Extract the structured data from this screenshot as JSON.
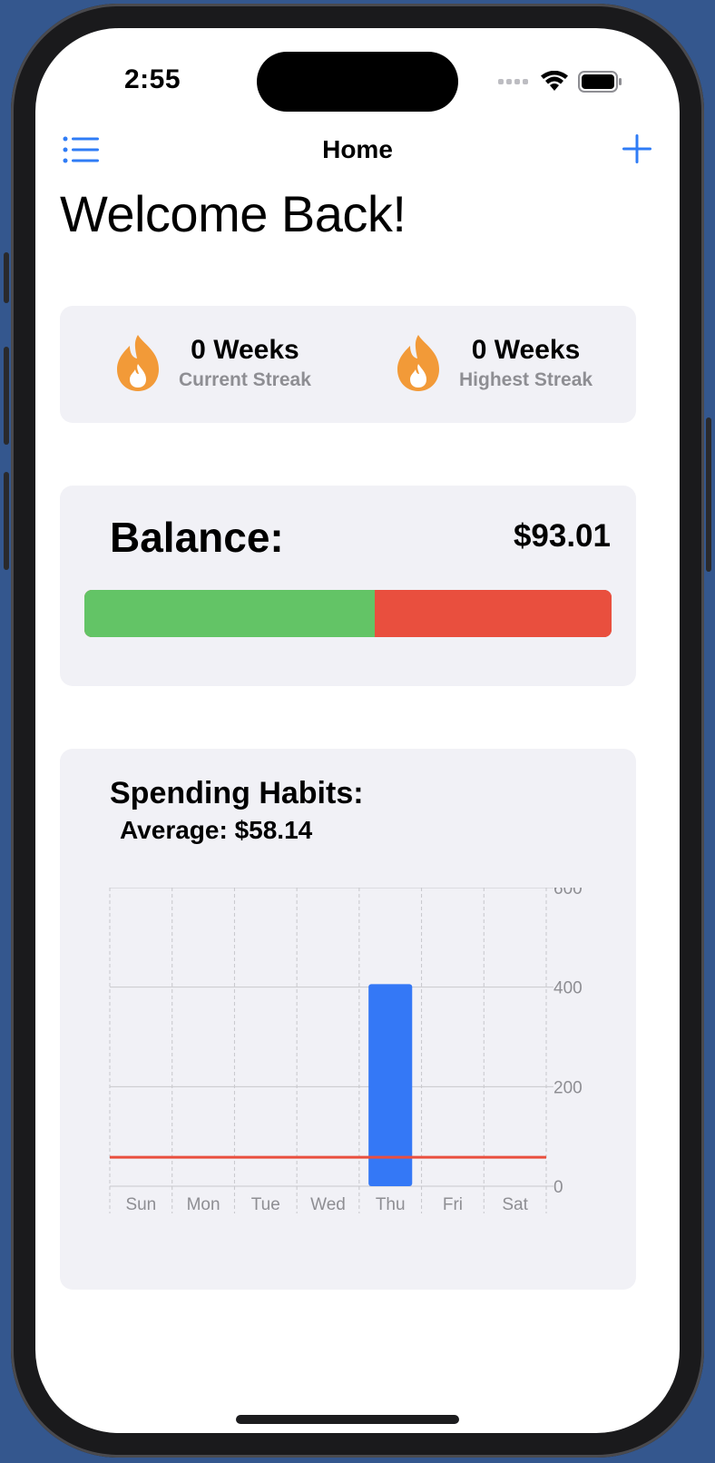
{
  "status_bar": {
    "time": "2:55",
    "icons": [
      "cellular-icon",
      "wifi-icon",
      "battery-icon"
    ]
  },
  "nav": {
    "title": "Home",
    "left_icon": "list-icon",
    "right_icon": "plus-icon"
  },
  "welcome": "Welcome Back!",
  "streaks": [
    {
      "value": "0 Weeks",
      "label": "Current Streak",
      "icon": "flame-icon"
    },
    {
      "value": "0 Weeks",
      "label": "Highest Streak",
      "icon": "flame-icon"
    }
  ],
  "balance": {
    "label": "Balance:",
    "value": "$93.01",
    "fill_fraction": 0.55,
    "fill_color": "#63c466",
    "remaining_color": "#e94f3e"
  },
  "spending": {
    "title": "Spending Habits:",
    "average_label": "Average: $58.14"
  },
  "colors": {
    "accent": "#2f7cf6",
    "bar": "#3478f6",
    "average_line": "#e94f3e",
    "flame": "#f29a38",
    "card_bg": "#f1f1f6"
  },
  "chart_data": {
    "type": "bar",
    "categories": [
      "Sun",
      "Mon",
      "Tue",
      "Wed",
      "Thu",
      "Fri",
      "Sat"
    ],
    "values": [
      0,
      0,
      0,
      0,
      406,
      0,
      0
    ],
    "yticks": [
      0,
      200,
      400,
      600
    ],
    "ylim": [
      0,
      600
    ],
    "average": 58.14,
    "grid": true,
    "y_axis_position": "right"
  }
}
